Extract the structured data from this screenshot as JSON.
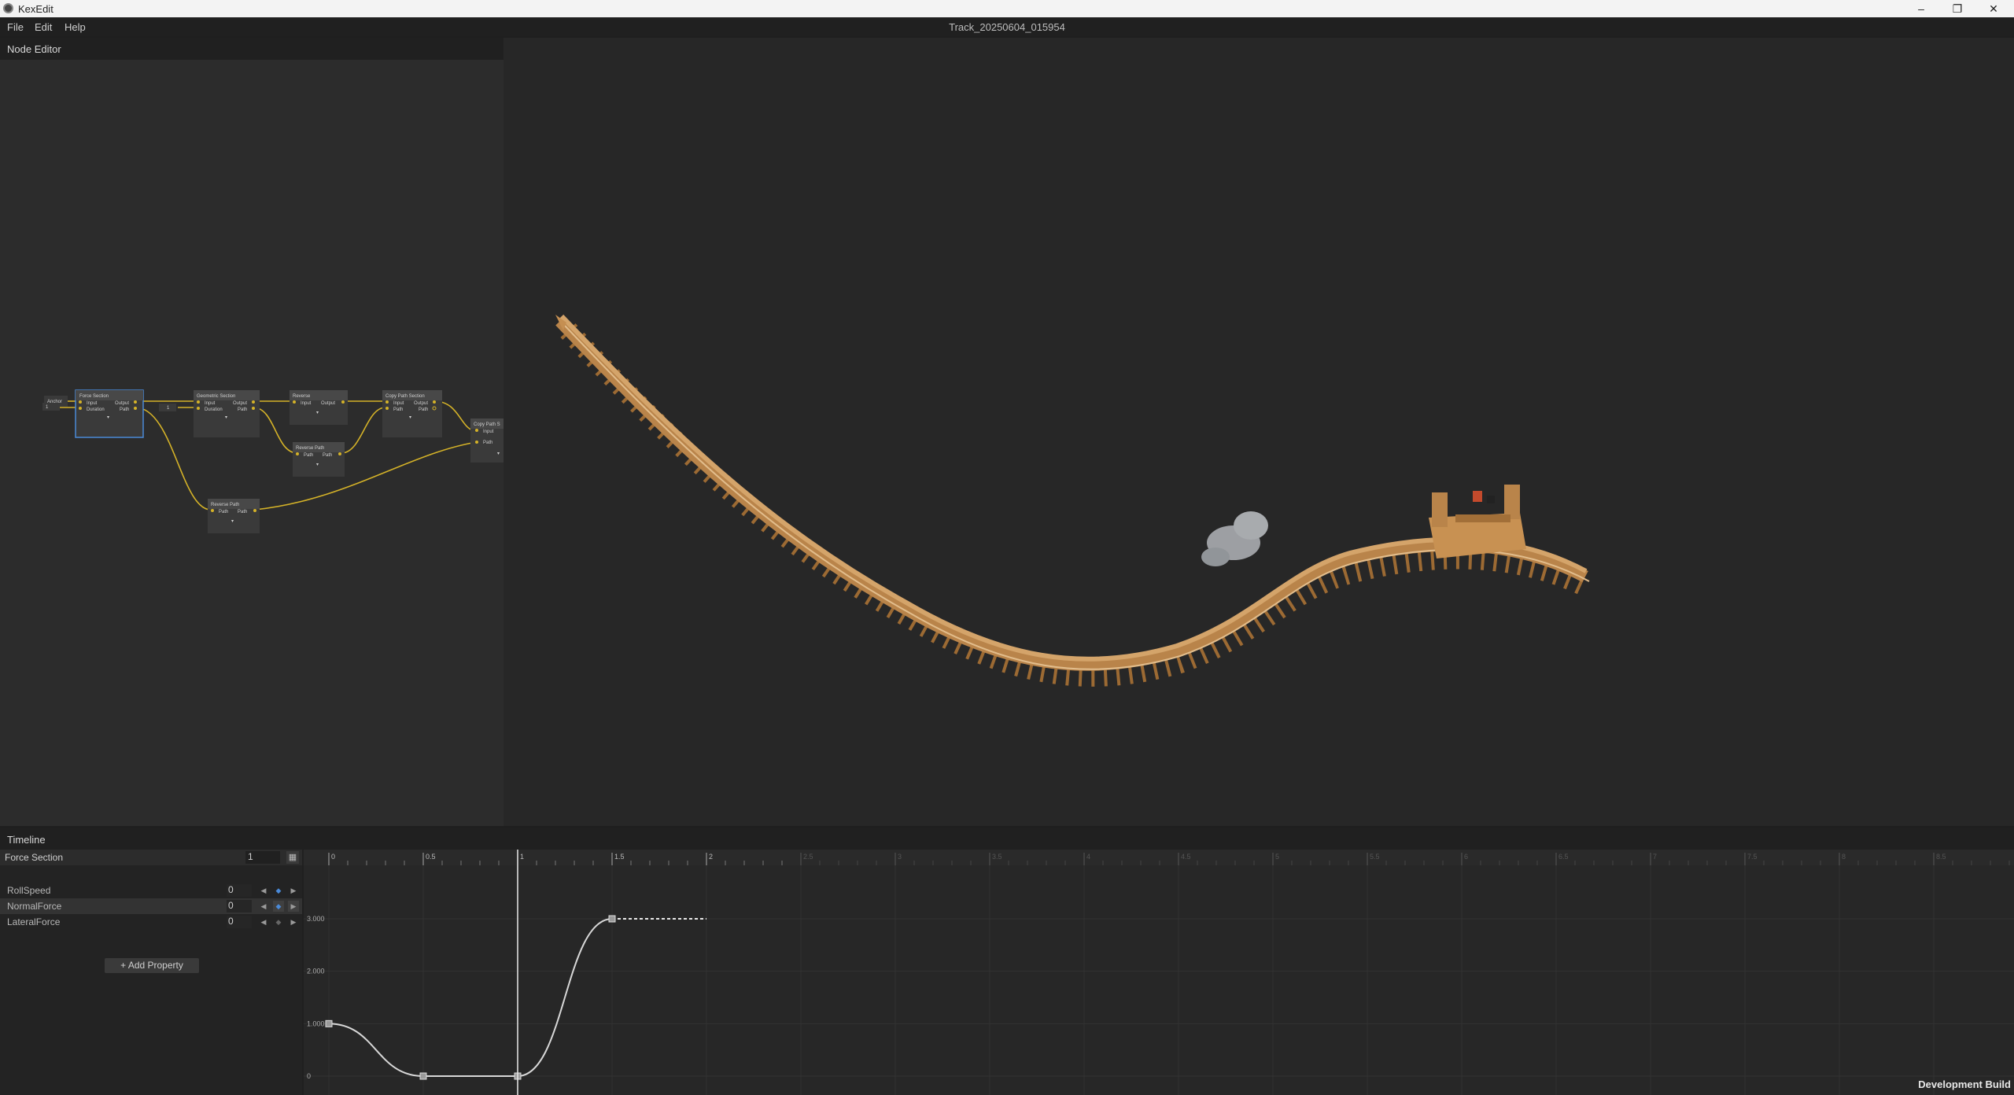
{
  "app": {
    "name": "KexEdit",
    "doc_title": "Track_20250604_015954"
  },
  "window_controls": {
    "minimize": "–",
    "maximize": "❐",
    "close": "✕"
  },
  "menu": [
    "File",
    "Edit",
    "Help"
  ],
  "node_editor": {
    "title": "Node Editor",
    "nodes": [
      {
        "id": "force",
        "title": "Force Section",
        "ports_in": [
          "Input",
          "Duration"
        ],
        "ports_out": [
          "Output",
          "Path"
        ],
        "selected": true
      },
      {
        "id": "geo",
        "title": "Geometric Section",
        "ports_in": [
          "Input",
          "Duration"
        ],
        "ports_out": [
          "Output",
          "Path"
        ],
        "selected": false
      },
      {
        "id": "rev",
        "title": "Reverse",
        "ports_in": [
          "Input"
        ],
        "ports_out": [
          "Output"
        ],
        "selected": false
      },
      {
        "id": "copy1",
        "title": "Copy Path Section",
        "ports_in": [
          "Input",
          "Path"
        ],
        "ports_out": [
          "Output",
          "Path"
        ],
        "selected": false
      },
      {
        "id": "revpath1",
        "title": "Reverse Path",
        "ports_in": [
          "Path"
        ],
        "ports_out": [
          "Path"
        ],
        "selected": false
      },
      {
        "id": "revpath2",
        "title": "Reverse Path",
        "ports_in": [
          "Path"
        ],
        "ports_out": [
          "Path"
        ],
        "selected": false
      },
      {
        "id": "copy2",
        "title": "Copy Path S",
        "ports_in": [
          "Input",
          "Path"
        ],
        "ports_out": [],
        "selected": false
      }
    ],
    "anchor_label": "Anchor",
    "duration_value": "1",
    "geo_duration_value": "1"
  },
  "timeline": {
    "title": "Timeline",
    "section_label": "Force Section",
    "section_value": "1",
    "properties": [
      {
        "name": "RollSpeed",
        "value": "0",
        "selected": false
      },
      {
        "name": "NormalForce",
        "value": "0",
        "selected": true
      },
      {
        "name": "LateralForce",
        "value": "0",
        "selected": false
      }
    ],
    "add_property_label": "+ Add Property",
    "ruler_labels": [
      "0",
      "0.5",
      "1",
      "1.5",
      "2",
      "2.5",
      "3",
      "3.5",
      "4",
      "4.5",
      "5",
      "5.5",
      "6",
      "6.5",
      "7",
      "7.5",
      "8",
      "8.5",
      "9",
      "9.5"
    ],
    "y_labels": [
      "3.000",
      "2.000",
      "1.000",
      "0"
    ],
    "playhead_time": 1,
    "curve_keyframes": [
      {
        "t": 0,
        "v": 1
      },
      {
        "t": 0.5,
        "v": 0
      },
      {
        "t": 1,
        "v": 0
      },
      {
        "t": 1.5,
        "v": 3
      }
    ],
    "curve_end_time": 2
  },
  "status": {
    "build_label": "Development Build"
  }
}
